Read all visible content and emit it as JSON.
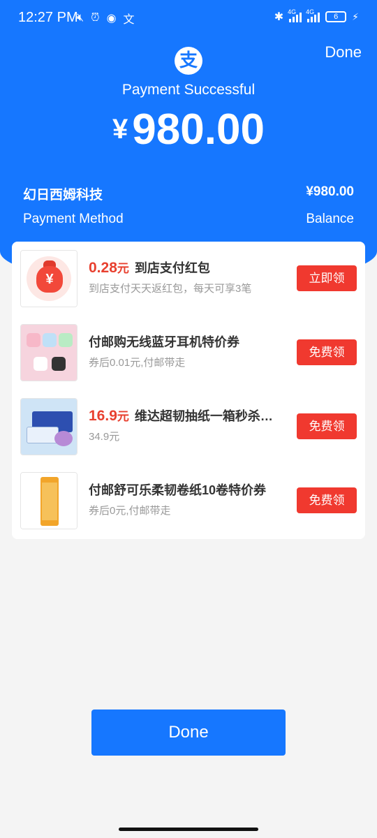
{
  "status_bar": {
    "time": "12:27 PM",
    "net_1": "4G",
    "net_2": "4G",
    "battery": "6"
  },
  "header": {
    "done_label": "Done",
    "logo_glyph": "支",
    "title": "Payment Successful",
    "currency_symbol": "¥",
    "amount": "980.00"
  },
  "summary": {
    "merchant": "幻日西姆科技",
    "merchant_amount": "¥980.00",
    "method_label": "Payment Method",
    "method_value": "Balance"
  },
  "offers": [
    {
      "price": "0.28",
      "price_unit": "元",
      "title": "到店支付红包",
      "subtitle": "到店支付天天返红包，每天可享3笔",
      "button": "立即领",
      "icon": "red-envelope-icon"
    },
    {
      "price": "",
      "price_unit": "",
      "title": "付邮购无线蓝牙耳机特价券",
      "subtitle": "券后0.01元,付邮带走",
      "button": "免费领",
      "icon": "earbuds-product-image"
    },
    {
      "price": "16.9",
      "price_unit": "元",
      "title": "维达超韧抽纸一箱秒杀…",
      "subtitle": "34.9元",
      "button": "免费领",
      "icon": "tissue-product-image"
    },
    {
      "price": "",
      "price_unit": "",
      "title": "付邮舒可乐柔韧卷纸10卷特价券",
      "subtitle": "券后0元,付邮带走",
      "button": "免费领",
      "icon": "toilet-paper-product-image"
    }
  ],
  "footer": {
    "done_label": "Done"
  },
  "colors": {
    "brand_blue": "#1677ff",
    "accent_red": "#f0392f",
    "price_red": "#e8402f"
  }
}
